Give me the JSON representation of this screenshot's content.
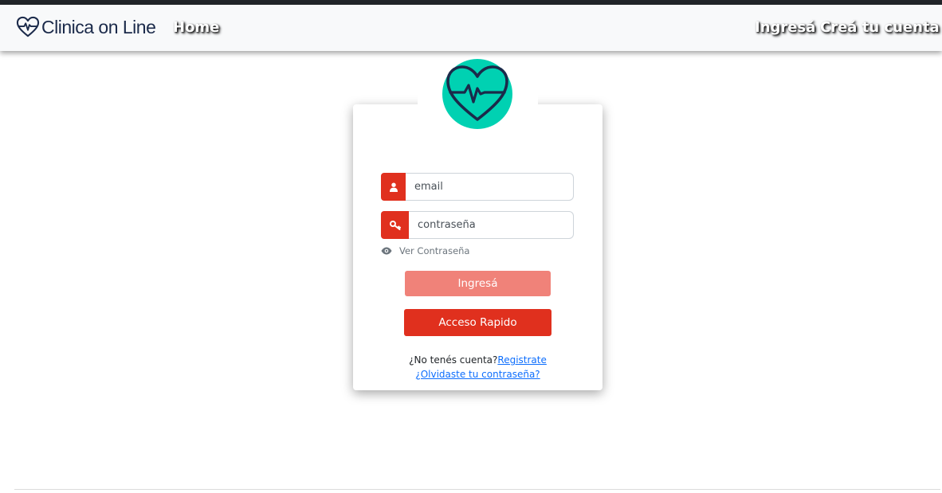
{
  "navbar": {
    "brand": "Clinica on Line",
    "home": "Home",
    "login": "Ingresá",
    "register": "Creá tu cuenta"
  },
  "form": {
    "email_placeholder": "email",
    "password_placeholder": "contraseña",
    "show_password": "Ver Contraseña",
    "login_button": "Ingresá",
    "quick_access_button": "Acceso Rapido",
    "no_account": "¿No tenés cuenta?",
    "register_link": "Registrate",
    "forgot_link": "¿Olvidaste tu contraseña?"
  },
  "icons": {
    "brand": "heart-pulse-icon",
    "avatar": "heart-pulse-icon",
    "email": "user-icon",
    "password": "key-icon",
    "show_password": "eye-icon"
  },
  "colors": {
    "accent": "#e0301e",
    "accent_light": "#f08279",
    "avatar_bg": "#00d1b2",
    "brand_text": "#1b2a4a",
    "link": "#0d6efd"
  }
}
